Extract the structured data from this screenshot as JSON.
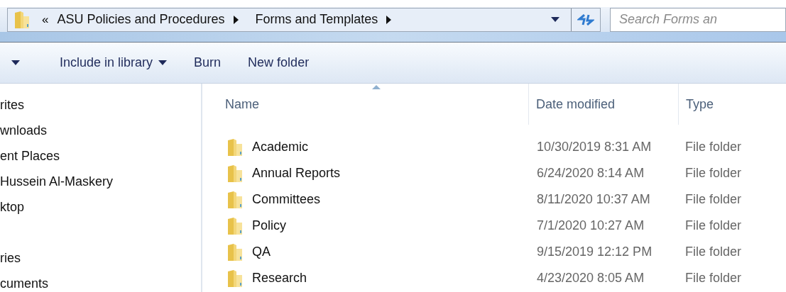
{
  "address_bar": {
    "overflow": "«",
    "crumbs": [
      "ASU Policies and Procedures",
      "Forms and Templates"
    ]
  },
  "search": {
    "placeholder": "Search Forms an"
  },
  "toolbar": {
    "buttons": [
      {
        "label": "Include in library",
        "dropdown": true
      },
      {
        "label": "Burn",
        "dropdown": false
      },
      {
        "label": "New folder",
        "dropdown": false
      }
    ]
  },
  "sidebar": {
    "groups": [
      [
        "rites",
        "wnloads",
        "ent Places",
        "Hussein Al-Maskery",
        "ktop"
      ],
      [
        "ries",
        "cuments"
      ]
    ]
  },
  "table": {
    "columns": [
      {
        "label": "Name",
        "sorted": true
      },
      {
        "label": "Date modified",
        "sorted": false
      },
      {
        "label": "Type",
        "sorted": false
      }
    ],
    "rows": [
      {
        "name": "Academic",
        "date": "10/30/2019 8:31 AM",
        "type": "File folder"
      },
      {
        "name": "Annual Reports",
        "date": "6/24/2020 8:14 AM",
        "type": "File folder"
      },
      {
        "name": "Committees",
        "date": "8/11/2020 10:37 AM",
        "type": "File folder"
      },
      {
        "name": "Policy",
        "date": "7/1/2020 10:27 AM",
        "type": "File folder"
      },
      {
        "name": "QA",
        "date": "9/15/2019 12:12 PM",
        "type": "File folder"
      },
      {
        "name": "Research",
        "date": "4/23/2020 8:05 AM",
        "type": "File folder"
      }
    ]
  }
}
